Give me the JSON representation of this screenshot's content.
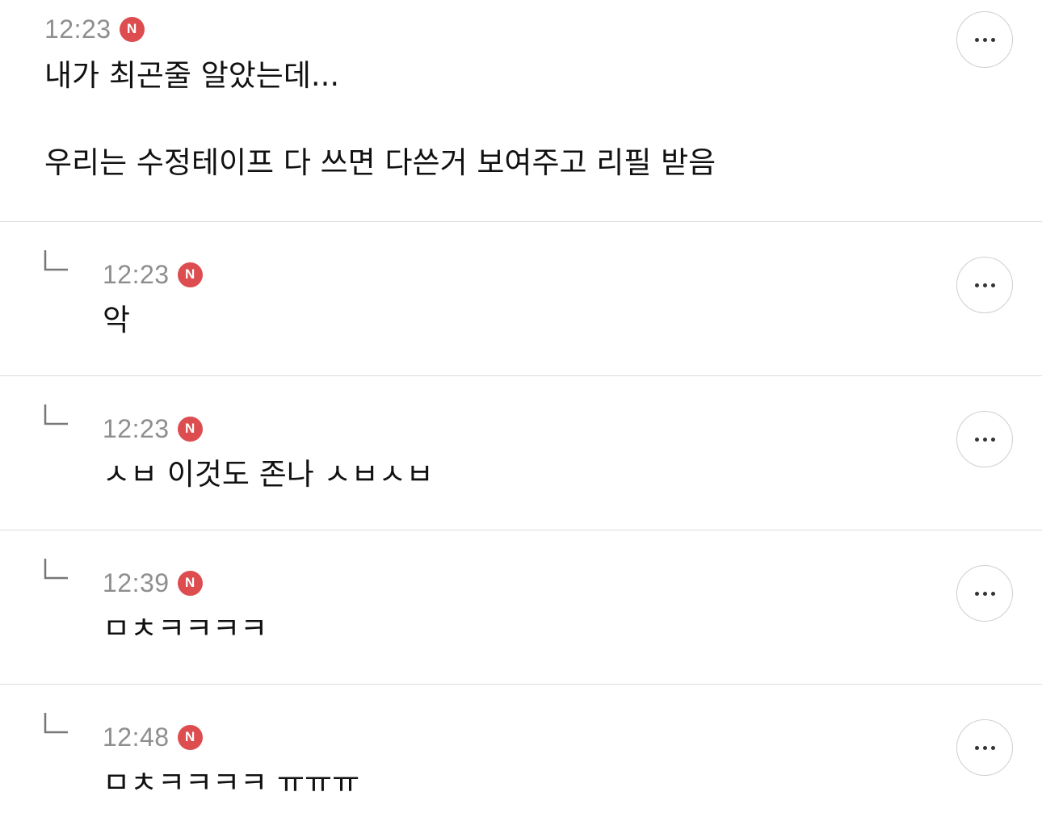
{
  "comments": [
    {
      "time": "12:23",
      "badge": "N",
      "text": "내가 최곤줄 알았는데...\n\n우리는 수정테이프 다 쓰면 다쓴거 보여주고 리필 받음",
      "is_reply": false
    },
    {
      "time": "12:23",
      "badge": "N",
      "text": "악",
      "is_reply": true
    },
    {
      "time": "12:23",
      "badge": "N",
      "text": "ㅅㅂ 이것도 존나 ㅅㅂㅅㅂ",
      "is_reply": true
    },
    {
      "time": "12:39",
      "badge": "N",
      "text": "ㅁㅊㅋㅋㅋㅋ",
      "is_reply": true
    },
    {
      "time": "12:48",
      "badge": "N",
      "text": "ㅁㅊㅋㅋㅋㅋ ㅠㅠㅠ",
      "is_reply": true
    }
  ],
  "icons": {
    "more": "more-horizontal-icon",
    "reply": "reply-arrow-icon"
  },
  "colors": {
    "badge": "#dd4d4f",
    "time": "#8e8e8e",
    "divider": "#dcdcdc"
  }
}
